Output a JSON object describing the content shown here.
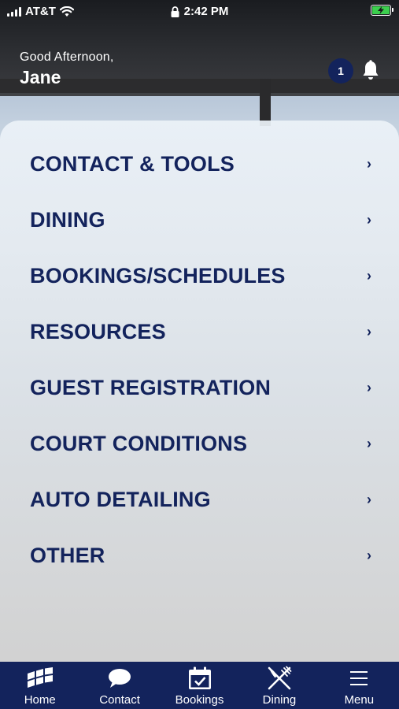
{
  "status_bar": {
    "carrier": "AT&T",
    "time": "2:42 PM",
    "icons": [
      "signal-icon",
      "wifi-icon",
      "lock-icon",
      "battery-charging-icon"
    ]
  },
  "header": {
    "greeting": "Good Afternoon,",
    "user_name": "Jane",
    "notification_count": "1",
    "bell_icon": "bell-icon"
  },
  "menu": {
    "items": [
      {
        "label": "CONTACT & TOOLS",
        "chevron": "›"
      },
      {
        "label": "DINING",
        "chevron": "›"
      },
      {
        "label": "BOOKINGS/SCHEDULES",
        "chevron": "›"
      },
      {
        "label": "RESOURCES",
        "chevron": "›"
      },
      {
        "label": "GUEST REGISTRATION",
        "chevron": "›"
      },
      {
        "label": "COURT CONDITIONS",
        "chevron": "›"
      },
      {
        "label": "AUTO DETAILING",
        "chevron": "›"
      },
      {
        "label": "OTHER",
        "chevron": "›"
      }
    ]
  },
  "tab_bar": {
    "tabs": [
      {
        "label": "Home",
        "icon": "home-icon"
      },
      {
        "label": "Contact",
        "icon": "chat-bubble-icon"
      },
      {
        "label": "Bookings",
        "icon": "calendar-check-icon"
      },
      {
        "label": "Dining",
        "icon": "fork-knife-icon"
      },
      {
        "label": "Menu",
        "icon": "hamburger-icon"
      }
    ]
  },
  "colors": {
    "navy": "#13235c",
    "battery_green": "#3ccf4e",
    "white": "#ffffff"
  }
}
